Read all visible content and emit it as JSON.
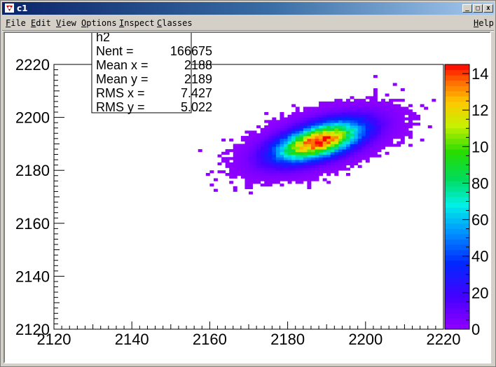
{
  "window": {
    "title": "c1",
    "controls": [
      "_",
      "□",
      "x"
    ]
  },
  "menu": {
    "items": [
      "File",
      "Edit",
      "View",
      "Options",
      "Inspect",
      "Classes"
    ],
    "help": "Help"
  },
  "stats": {
    "name": "h2",
    "lines": [
      {
        "label": "Nent = ",
        "value": "166675"
      },
      {
        "label": "Mean x = ",
        "value": "2188"
      },
      {
        "label": "Mean y = ",
        "value": "2189"
      },
      {
        "label": "RMS x = ",
        "value": "7.427"
      },
      {
        "label": "RMS y = ",
        "value": "5.022"
      }
    ]
  },
  "chart_data": {
    "type": "heatmap",
    "title": "",
    "xlabel": "",
    "ylabel": "",
    "xlim": [
      2120,
      2220
    ],
    "ylim": [
      2120,
      2220
    ],
    "x_ticks": [
      2120,
      2140,
      2160,
      2180,
      2200,
      2220
    ],
    "y_ticks": [
      2120,
      2140,
      2160,
      2180,
      2200,
      2220
    ],
    "x_tick_labels": [
      "2120",
      "2140",
      "2160",
      "2180",
      "2200",
      "2220"
    ],
    "y_tick_labels": [
      "2120",
      "2140",
      "2160",
      "2180",
      "2200",
      "2220"
    ],
    "z_range": [
      0,
      145
    ],
    "palette": "rainbow",
    "colorbar_tick_labels": [
      "0",
      "20",
      "40",
      "60",
      "80",
      "10",
      "12",
      "14"
    ],
    "colorbar_tick_values": [
      0,
      20,
      40,
      60,
      80,
      100,
      120,
      140
    ],
    "entries": 166675,
    "mean_x": 2188,
    "mean_y": 2189,
    "rms_x": 7.427,
    "rms_y": 5.022,
    "peak": [
      2188,
      2191
    ],
    "peak_value": 145,
    "correlation": 0.55
  }
}
